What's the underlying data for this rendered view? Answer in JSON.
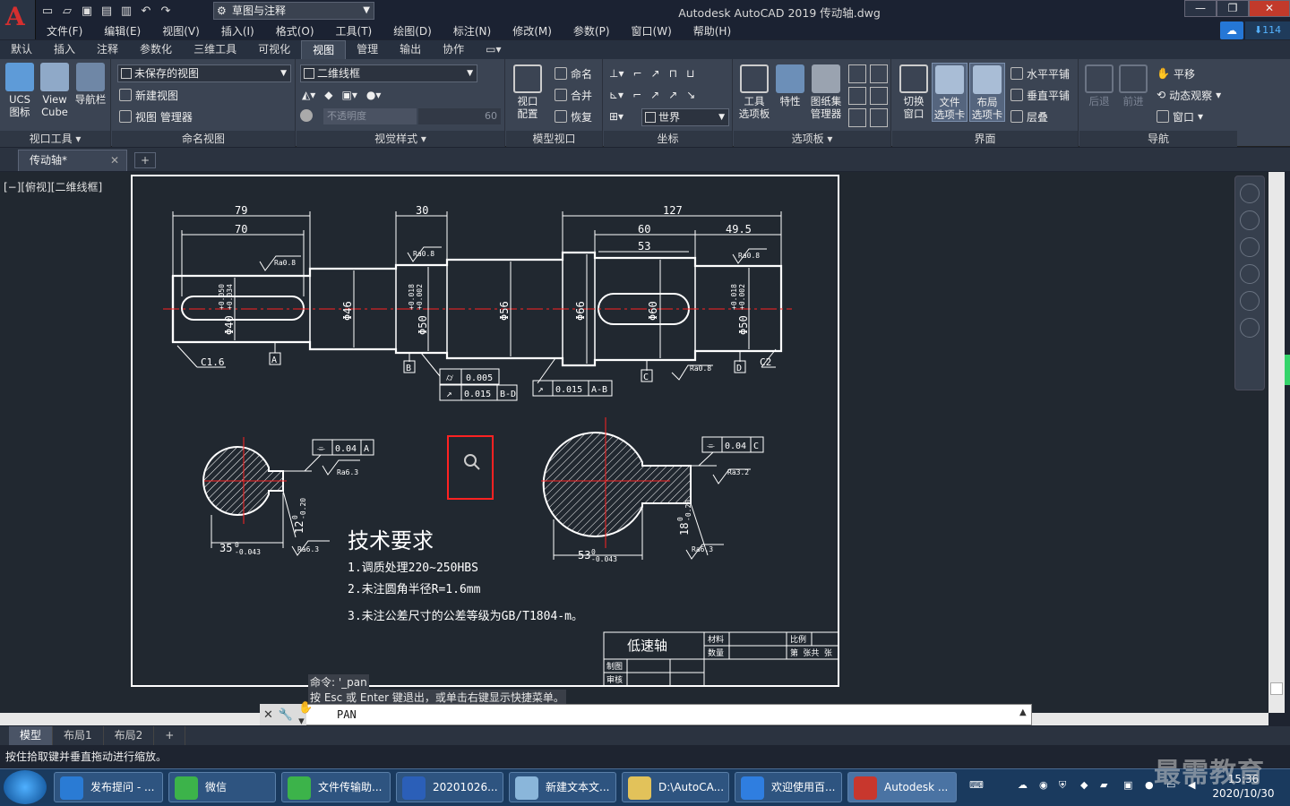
{
  "app": {
    "title": "Autodesk AutoCAD 2019    传动轴.dwg",
    "workspace": "草图与注释"
  },
  "menus": [
    "文件(F)",
    "编辑(E)",
    "视图(V)",
    "插入(I)",
    "格式(O)",
    "工具(T)",
    "绘图(D)",
    "标注(N)",
    "修改(M)",
    "参数(P)",
    "窗口(W)",
    "帮助(H)"
  ],
  "cloud_count": "114",
  "tabs": [
    "默认",
    "插入",
    "注释",
    "参数化",
    "三维工具",
    "可视化",
    "视图",
    "管理",
    "输出",
    "协作"
  ],
  "active_tab": "视图",
  "ribbon": {
    "viewport_tools": {
      "title": "视口工具",
      "ucs": "UCS\n图标",
      "viewcube": "View\nCube",
      "navbar": "导航栏"
    },
    "named_views": {
      "title": "命名视图",
      "combo": "未保存的视图",
      "new_view": "新建视图",
      "view_manager": "视图 管理器"
    },
    "visual_styles": {
      "title": "视觉样式",
      "combo": "二维线框",
      "opacity_label": "不透明度",
      "opacity_value": "60"
    },
    "model_viewports": {
      "title": "模型视口",
      "config": "视口\n配置",
      "named": "命名",
      "join": "合并",
      "restore": "恢复"
    },
    "coordinates": {
      "title": "坐标",
      "ucs_combo": "世界"
    },
    "palettes": {
      "title": "选项板",
      "tool_palettes": "工具\n选项板",
      "properties": "特性",
      "sheetset": "图纸集\n管理器"
    },
    "interface": {
      "title": "界面",
      "switch": "切换\n窗口",
      "file_tabs": "文件\n选项卡",
      "layout_tabs": "布局\n选项卡",
      "tile_h": "水平平铺",
      "tile_v": "垂直平铺",
      "cascade": "层叠"
    },
    "navigate": {
      "title": "导航",
      "back": "后退",
      "forward": "前进",
      "pan": "平移",
      "orbit": "动态观察",
      "window": "窗口"
    }
  },
  "file_tab": "传动轴*",
  "view_label": "[−][俯视][二维线框]",
  "drawing": {
    "dims_top": [
      "79",
      "70",
      "30",
      "127",
      "60",
      "49.5",
      "53"
    ],
    "roughness": [
      "Ra0.8",
      "Ra0.8",
      "Ra0.8",
      "Ra0.8",
      "Ra6.3",
      "Ra6.3",
      "Ra3.2",
      "Ra6.3"
    ],
    "diameters": [
      "Φ40",
      "Φ46",
      "Φ50",
      "Φ56",
      "Φ66",
      "Φ60",
      "Φ50"
    ],
    "tol_40": [
      "+0.050",
      "+0.034"
    ],
    "tol_50a": [
      "+0.018",
      "+0.002"
    ],
    "tol_50b": [
      "+0.018",
      "+0.002"
    ],
    "chamfers": [
      "C1.6",
      "C2"
    ],
    "datums": [
      "A",
      "B",
      "C",
      "D"
    ],
    "frames": {
      "f1a": "0.005",
      "f1b": "0.015",
      "f1b_ref": "B-D",
      "f2": "0.015",
      "f2_ref": "A-B",
      "sym1": "0.04",
      "sym1_ref": "A",
      "sym2": "0.04",
      "sym2_ref": "C"
    },
    "section1": {
      "width": "35",
      "width_tol": "0\n-0.043",
      "key": "12",
      "key_tol": "0\n-0.20"
    },
    "section2": {
      "width": "53",
      "width_tol": "0\n-0.043",
      "key": "18",
      "key_tol": "0\n-0.20"
    },
    "tech_title": "技术要求",
    "tech_items": [
      "1.调质处理220~250HBS",
      "2.未注圆角半径R=1.6mm",
      "3.未注公差尺寸的公差等级为GB/T1804-m。"
    ],
    "titleblock": {
      "name": "低速轴",
      "material": "材料",
      "scale": "比例",
      "qty": "数量",
      "sheets": "第  张共  张",
      "drawn": "制图",
      "checked": "审核"
    }
  },
  "command": {
    "history1": "命令: '_pan",
    "history2": "按 Esc 或 Enter 键退出，或单击右键显示快捷菜单。",
    "current": "PAN"
  },
  "layout_tabs": [
    "模型",
    "布局1",
    "布局2"
  ],
  "status": "按住拾取键并垂直拖动进行缩放。",
  "taskbar": [
    "发布提问 - ...",
    "微信",
    "文件传输助...",
    "20201026...",
    "新建文本文...",
    "D:\\AutoCA...",
    "欢迎使用百...",
    "Autodesk ..."
  ],
  "clock": {
    "time": "15:36",
    "date": "2020/10/30"
  },
  "watermark": "最需教育"
}
